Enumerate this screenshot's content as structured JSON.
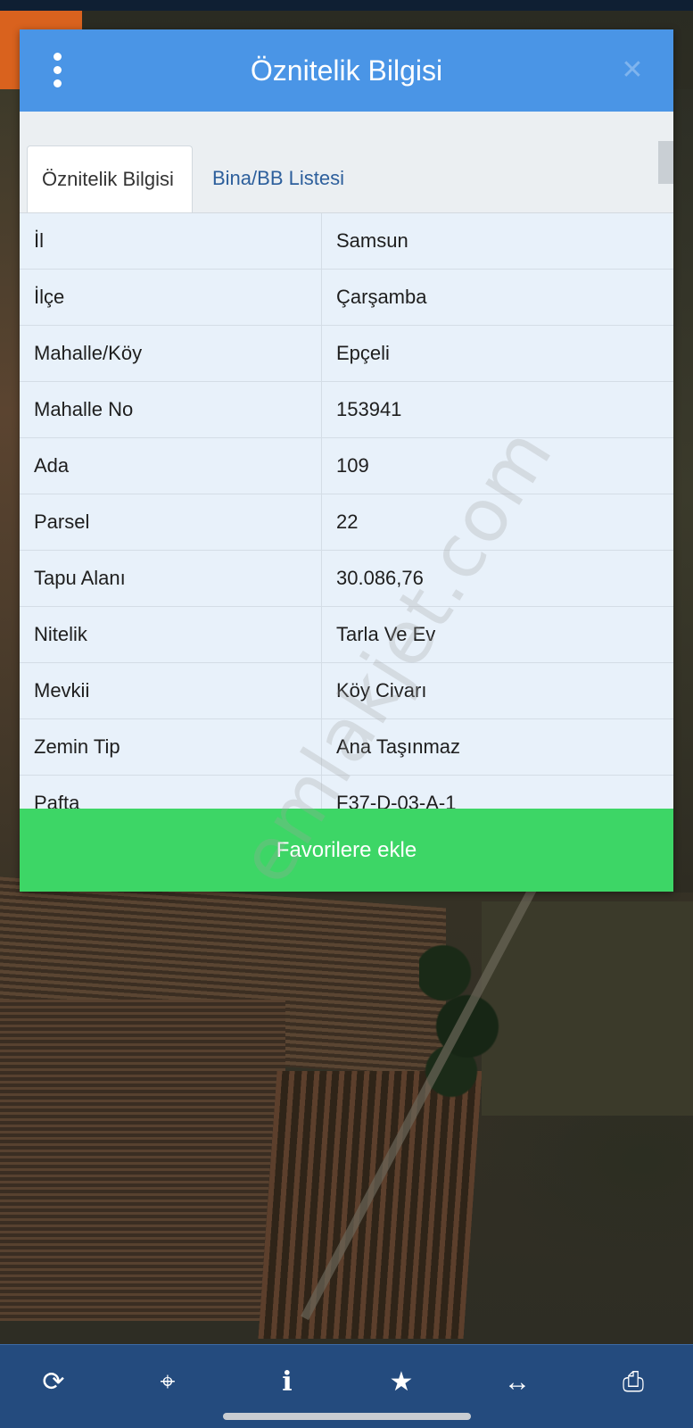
{
  "popup": {
    "title": "Öznitelik Bilgisi",
    "menu_icon": "vertical-dots-icon",
    "close_icon": "close-icon"
  },
  "tabs": [
    {
      "label": "Öznitelik Bilgisi",
      "active": true
    },
    {
      "label": "Bina/BB Listesi",
      "active": false
    }
  ],
  "attributes": [
    {
      "key": "İl",
      "value": "Samsun"
    },
    {
      "key": "İlçe",
      "value": "Çarşamba"
    },
    {
      "key": "Mahalle/Köy",
      "value": "Epçeli"
    },
    {
      "key": "Mahalle No",
      "value": "153941"
    },
    {
      "key": "Ada",
      "value": "109"
    },
    {
      "key": "Parsel",
      "value": "22"
    },
    {
      "key": "Tapu Alanı",
      "value": "30.086,76"
    },
    {
      "key": "Nitelik",
      "value": "Tarla Ve Ev"
    },
    {
      "key": "Mevkii",
      "value": "Köy Civarı"
    },
    {
      "key": "Zemin Tip",
      "value": "Ana Taşınmaz"
    },
    {
      "key": "Pafta",
      "value": "F37-D-03-A-1"
    }
  ],
  "favorite_button": "Favorilere ekle",
  "watermark": "emlakjet.com",
  "toolbar": [
    {
      "icon": "refresh-icon"
    },
    {
      "icon": "crosshair-icon"
    },
    {
      "icon": "info-icon"
    },
    {
      "icon": "star-icon"
    },
    {
      "icon": "measure-arrows-icon"
    },
    {
      "icon": "print-icon"
    }
  ],
  "colors": {
    "header": "#4a95e6",
    "favorite_button": "#3dd666",
    "toolbar": "#244b7e",
    "table_bg": "#e8f1fa"
  }
}
